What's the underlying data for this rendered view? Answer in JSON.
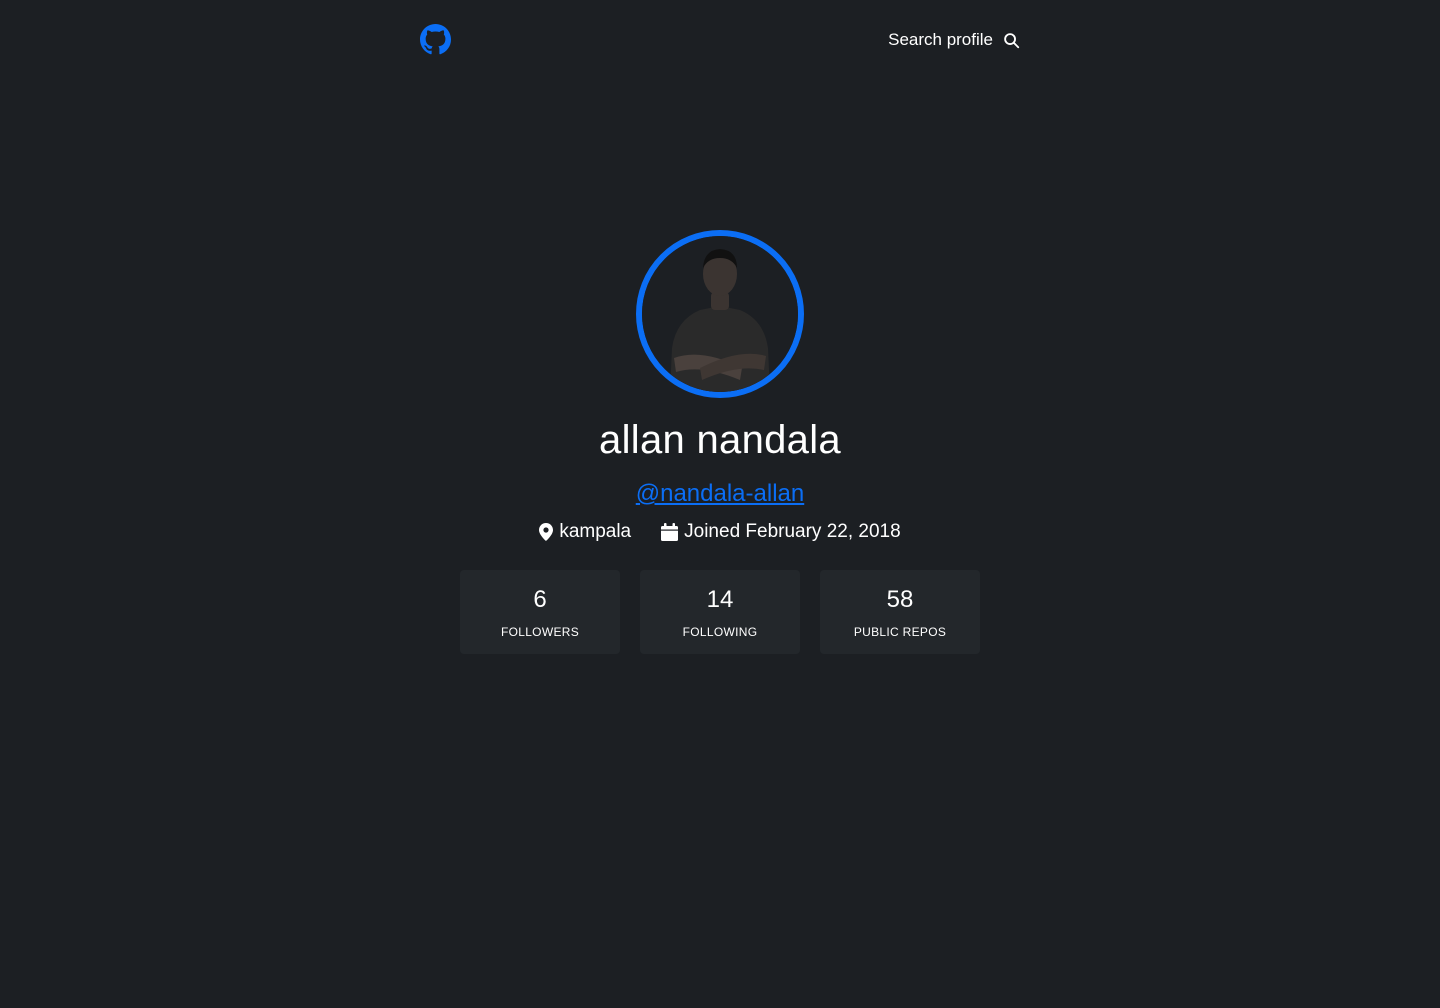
{
  "header": {
    "logo_icon": "github-icon",
    "search_label": "Search profile",
    "search_icon": "search-icon"
  },
  "profile": {
    "name": "allan nandala",
    "login": "@nandala-allan",
    "location": "kampala",
    "location_icon": "map-pin-icon",
    "joined": "Joined February 22, 2018",
    "joined_icon": "calendar-icon"
  },
  "stats": [
    {
      "value": "6",
      "label": "FOLLOWERS"
    },
    {
      "value": "14",
      "label": "FOLLOWING"
    },
    {
      "value": "58",
      "label": "PUBLIC REPOS"
    }
  ],
  "colors": {
    "background": "#1c1f23",
    "accent": "#0b6ef5",
    "card": "#23272b",
    "text": "#ffffff"
  }
}
